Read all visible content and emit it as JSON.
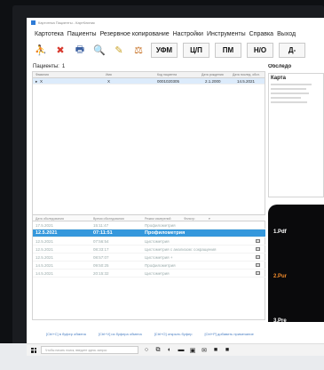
{
  "window": {
    "title": "Картотека Пациенты - КартКлиник"
  },
  "menu": [
    "Картотека",
    "Пациенты",
    "Резервное копирование",
    "Настройки",
    "Инструменты",
    "Справка",
    "Выход"
  ],
  "toolbar": {
    "icons": [
      {
        "name": "add-patient-icon",
        "glyph": "⛹",
        "color": "#2f9a3c"
      },
      {
        "name": "delete-icon",
        "glyph": "✖",
        "color": "#d83a2e"
      },
      {
        "name": "print-icon",
        "glyph": "🖶",
        "color": "#3a5fa0"
      },
      {
        "name": "search-icon",
        "glyph": "🔍",
        "color": "#444444"
      },
      {
        "name": "brush-icon",
        "glyph": "✎",
        "color": "#c9a227"
      },
      {
        "name": "scales-icon",
        "glyph": "⚖",
        "color": "#c46a1a"
      }
    ],
    "buttons": [
      "УФМ",
      "Ц/П",
      "ПМ",
      "Н/О",
      "Д-"
    ]
  },
  "patients": {
    "label": "Пациенты:",
    "count": "1",
    "columns": [
      "Фамилия",
      "Имя",
      "Код пациента",
      "Дата рождения",
      "Дата послед. обсл."
    ],
    "rows": [
      {
        "surname": "X",
        "name": "X",
        "code": "0001020305",
        "birth": "2.1.2000",
        "last": "14.5.2021"
      }
    ]
  },
  "exams": {
    "columns": [
      "Дата обследования",
      "Время обследования",
      "Режим измерений",
      "Фильтр:"
    ],
    "rows": [
      {
        "date": "17.5.2021",
        "time": "15:11:47",
        "mode": "Профилометрия",
        "active": false
      },
      {
        "date": "12.5.2021",
        "time": "07:11:51",
        "mode": "Профилометрия",
        "active": true
      },
      {
        "date": "12.5.2021",
        "time": "07:56:54",
        "mode": "Цистометрия",
        "active": false
      },
      {
        "date": "12.5.2021",
        "time": "08:33:17",
        "mode": "Цистометрия с анализом: сокращения",
        "active": false
      },
      {
        "date": "12.5.2021",
        "time": "08:57:07",
        "mode": "Цистометрия +",
        "active": false
      },
      {
        "date": "14.5.2021",
        "time": "09:50:25",
        "mode": "Профилометрия",
        "active": false
      },
      {
        "date": "14.5.2021",
        "time": "20:15:32",
        "mode": "Цистометрия",
        "active": false
      }
    ]
  },
  "right": {
    "section": "Обследо",
    "card_title": "Карта",
    "video_items": [
      {
        "label": "1.Pdf",
        "color": "#ffffff"
      },
      {
        "label": "2.Pur",
        "color": "#f08a2a"
      },
      {
        "label": "3.Pre",
        "color": "#ffffff"
      }
    ]
  },
  "status": [
    "[Ctrl+C] в буфер обмена",
    "[Ctrl+V] из буфера обмена",
    "[Ctrl+O] открыть буфер",
    "[Ctrl+P] добавить примечание"
  ],
  "taskbar": {
    "search_placeholder": "Чтобы начать поиск, введите здесь запрос",
    "apps": [
      {
        "name": "search-taskbar-icon",
        "glyph": "○"
      },
      {
        "name": "taskview-icon",
        "glyph": "⧉"
      },
      {
        "name": "edge-icon",
        "glyph": "◐"
      },
      {
        "name": "explorer-icon",
        "glyph": "▬"
      },
      {
        "name": "store-icon",
        "glyph": "▣"
      },
      {
        "name": "mail-icon",
        "glyph": "✉"
      },
      {
        "name": "app-icon-1",
        "glyph": "■"
      },
      {
        "name": "app-icon-2",
        "glyph": "■"
      }
    ]
  }
}
